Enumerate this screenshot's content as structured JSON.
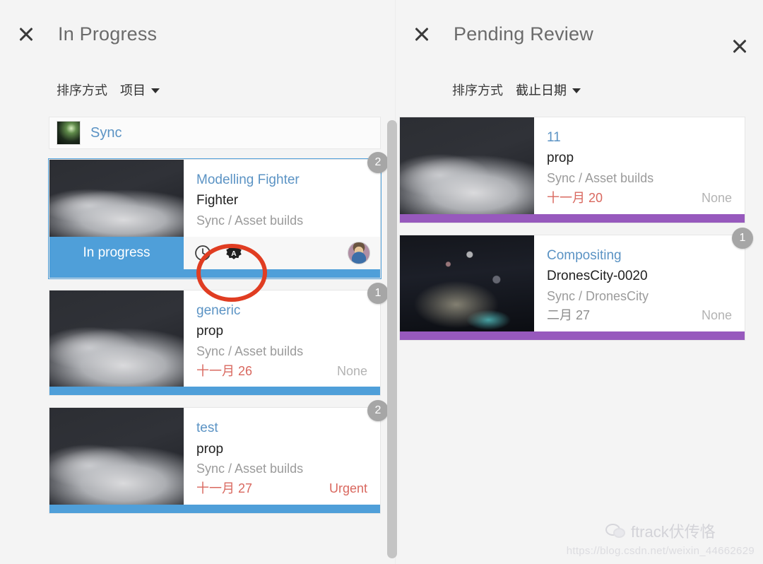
{
  "columns": [
    {
      "id": "in-progress",
      "title": "In Progress",
      "sort": {
        "label": "排序方式",
        "value": "项目"
      },
      "group": {
        "name": "Sync",
        "thumb_icon": "project-thumbnail"
      },
      "cards": [
        {
          "type": "Modelling Fighter",
          "name": "Fighter",
          "path": "Sync / Asset builds",
          "badge": "2",
          "selected": true,
          "status_label": "In progress",
          "status_color": "#4f9fd9",
          "icons": [
            "clock-icon",
            "badge-a-icon"
          ],
          "assignee_icon": "avatar"
        },
        {
          "type": "generic",
          "name": "prop",
          "path": "Sync / Asset builds",
          "date": "十一月 26",
          "date_state": "overdue",
          "priority": "None",
          "priority_state": "none",
          "badge": "1",
          "status_color": "#4f9fd9"
        },
        {
          "type": "test",
          "name": "prop",
          "path": "Sync / Asset builds",
          "date": "十一月 27",
          "date_state": "overdue",
          "priority": "Urgent",
          "priority_state": "urgent",
          "badge": "2",
          "status_color": "#4f9fd9"
        }
      ]
    },
    {
      "id": "pending-review",
      "title": "Pending Review",
      "sort": {
        "label": "排序方式",
        "value": "截止日期"
      },
      "cards": [
        {
          "type": "11",
          "name": "prop",
          "path": "Sync / Asset builds",
          "date": "十一月 20",
          "date_state": "overdue",
          "priority": "None",
          "priority_state": "none",
          "status_color": "#9759bd"
        },
        {
          "type": "Compositing",
          "name": "DronesCity-0020",
          "path": "Sync / DronesCity",
          "date": "二月 27",
          "date_state": "normal",
          "priority": "None",
          "priority_state": "none",
          "badge": "1",
          "status_color": "#9759bd"
        }
      ]
    }
  ],
  "watermark": {
    "name": "ftrack伏传恪",
    "url": "https://blog.csdn.net/weixin_44662629",
    "icon": "wechat-icon"
  },
  "annotation": {
    "shape": "circle",
    "color": "#e03d22"
  }
}
